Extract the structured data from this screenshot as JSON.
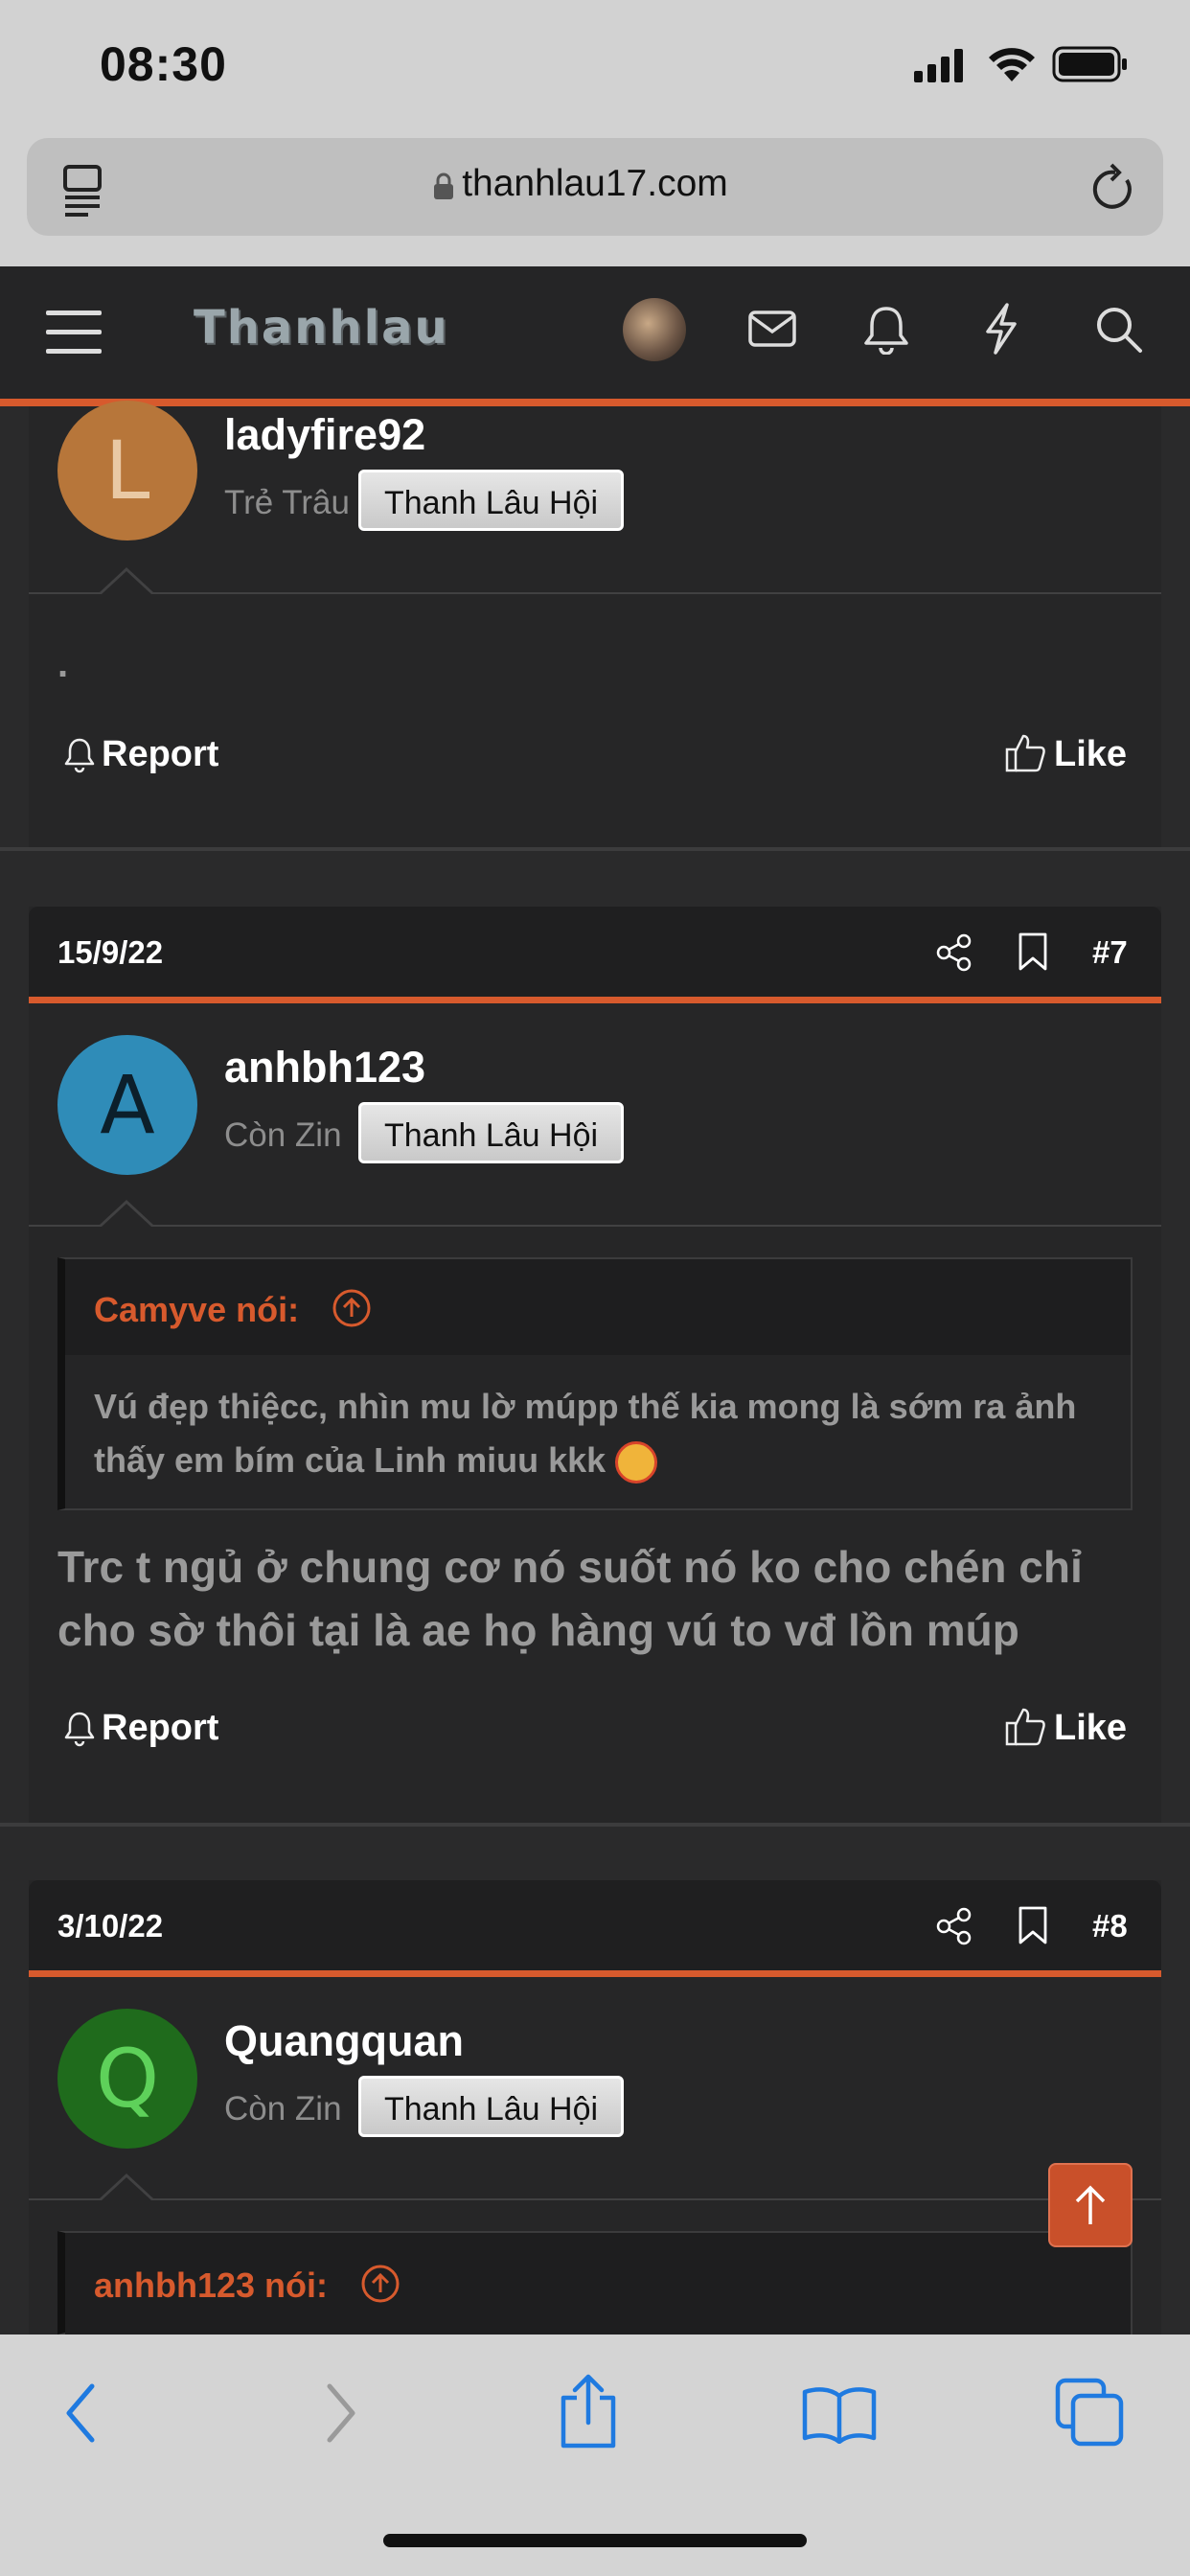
{
  "status": {
    "time": "08:30"
  },
  "browser": {
    "url": "thanhlau17.com"
  },
  "site": {
    "logo": "Thanhlau"
  },
  "posts": [
    {
      "username": "ladyfire92",
      "avatar_letter": "L",
      "avatar_color": "#b7763a",
      "rank": "Trẻ Trâu",
      "badge": "Thanh Lâu Hội",
      "body": ".",
      "report": "Report",
      "like": "Like"
    },
    {
      "date": "15/9/22",
      "number": "#7",
      "username": "anhbh123",
      "avatar_letter": "A",
      "avatar_color": "#2f8cb8",
      "rank": "Còn Zin",
      "badge": "Thanh Lâu Hội",
      "quote_author": "Camyve nói:",
      "quote_text": "Vú đẹp thiệcc, nhìn mu lờ múpp thế kia mong là sớm ra ảnh thấy em bím của Linh miuu kkk",
      "body": "Trc t ngủ ở chung cơ nó suốt nó ko cho chén chỉ cho sờ thôi tại là ae họ hàng vú to vđ lồn múp",
      "report": "Report",
      "like": "Like"
    },
    {
      "date": "3/10/22",
      "number": "#8",
      "username": "Quangquan",
      "avatar_letter": "Q",
      "avatar_color": "#1f6b1c",
      "rank": "Còn Zin",
      "badge": "Thanh Lâu Hội",
      "quote_author": "anhbh123 nói:"
    }
  ],
  "colors": {
    "accent": "#d75a2d",
    "background": "#2a2a2b"
  }
}
